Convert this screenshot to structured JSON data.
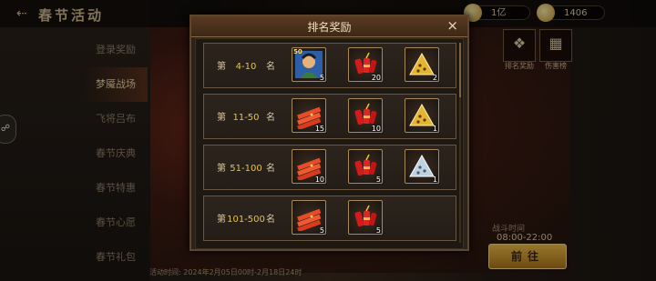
{
  "page": {
    "title": "春节活动",
    "resources": [
      {
        "icon": "coin-icon",
        "value": "1亿"
      },
      {
        "icon": "gold-ingot-icon",
        "value": "1406"
      }
    ],
    "menu": [
      "登录奖励",
      "梦魇战场",
      "飞将吕布",
      "春节庆典",
      "春节特惠",
      "春节心愿",
      "春节礼包"
    ],
    "active_menu": 1,
    "side_buttons": [
      {
        "label": "排名奖励",
        "icon": "reward-seal-icon"
      },
      {
        "label": "伤害榜",
        "icon": "damage-rank-icon"
      }
    ],
    "battle_time_title": "战斗时间",
    "battle_time": "08:00-22:00",
    "go_button": "前往",
    "activity_time": "活动时间: 2024年2月05日00时-2月18日24时"
  },
  "modal": {
    "title": "排名奖励",
    "close": "×",
    "rank_prefix": "第",
    "rank_suffix": "名",
    "rows": [
      {
        "range": "4-10",
        "items": [
          {
            "type": "hero-fragment",
            "icon": "hero-portrait-icon",
            "count": "5",
            "tag": "50"
          },
          {
            "type": "firecracker",
            "icon": "firecracker-icon",
            "count": "20"
          },
          {
            "type": "gold-pyramid",
            "icon": "gold-pyramid-icon",
            "count": "2"
          }
        ]
      },
      {
        "range": "11-50",
        "items": [
          {
            "type": "red-envelope",
            "icon": "red-envelope-icon",
            "count": "15"
          },
          {
            "type": "firecracker",
            "icon": "firecracker-icon",
            "count": "10"
          },
          {
            "type": "gold-pyramid",
            "icon": "gold-pyramid-icon",
            "count": "1"
          }
        ]
      },
      {
        "range": "51-100",
        "items": [
          {
            "type": "red-envelope",
            "icon": "red-envelope-icon",
            "count": "10"
          },
          {
            "type": "firecracker",
            "icon": "firecracker-icon",
            "count": "5"
          },
          {
            "type": "silver-pyramid",
            "icon": "silver-pyramid-icon",
            "count": "1"
          }
        ]
      },
      {
        "range": "101-500",
        "items": [
          {
            "type": "red-envelope",
            "icon": "red-envelope-icon",
            "count": "5"
          },
          {
            "type": "firecracker",
            "icon": "firecracker-icon",
            "count": "5"
          }
        ]
      }
    ]
  }
}
